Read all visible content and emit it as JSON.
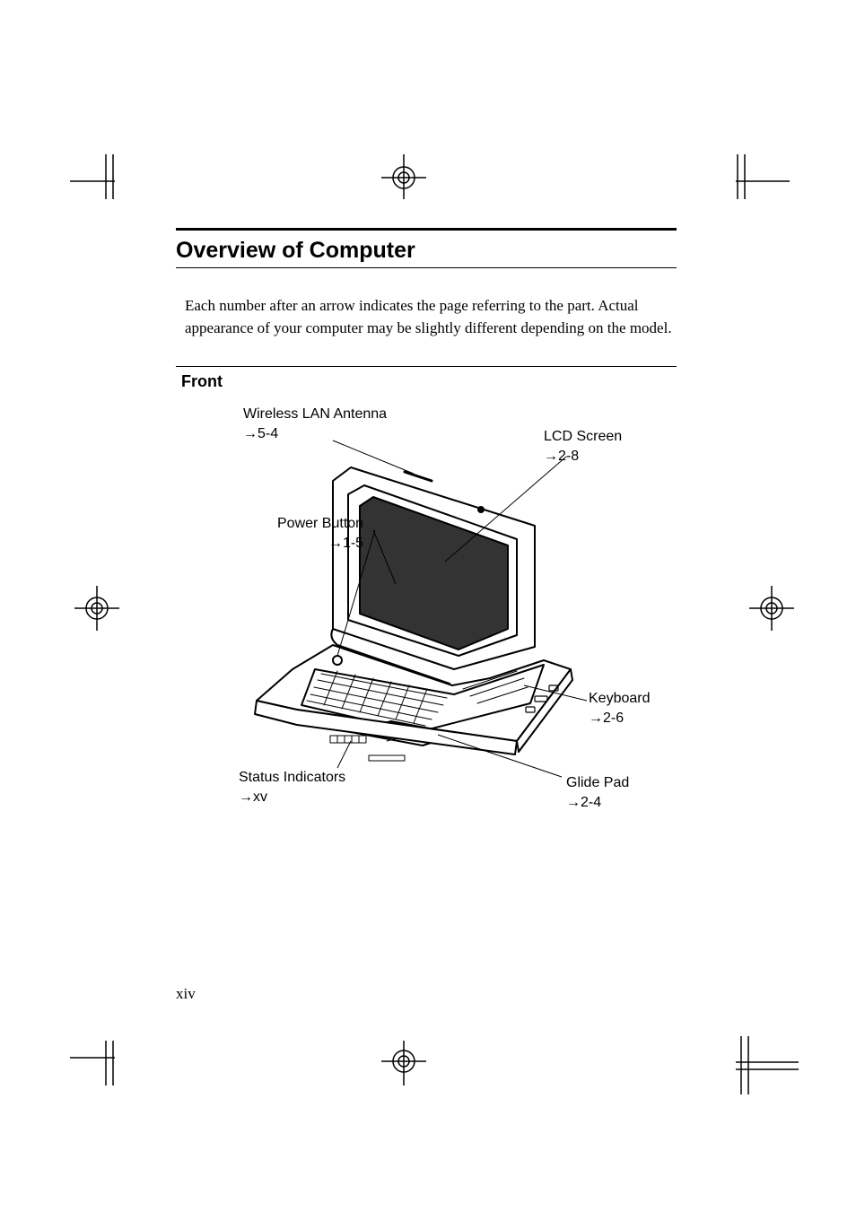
{
  "title": "Overview of Computer",
  "intro": "Each number after an arrow indicates the page referring to the part. Actual appearance of your computer may be slightly different depending on the model.",
  "section": "Front",
  "page_number": "xiv",
  "callouts": {
    "wlan": {
      "label": "Wireless LAN Antenna",
      "ref": "5-4"
    },
    "lcd": {
      "label": "LCD Screen",
      "ref": "2-8"
    },
    "power": {
      "label": "Power Button",
      "ref": "1-5"
    },
    "keyboard": {
      "label": "Keyboard",
      "ref": "2-6"
    },
    "glide": {
      "label": "Glide Pad",
      "ref": "2-4"
    },
    "status": {
      "label": "Status Indicators",
      "ref": "xv"
    }
  }
}
